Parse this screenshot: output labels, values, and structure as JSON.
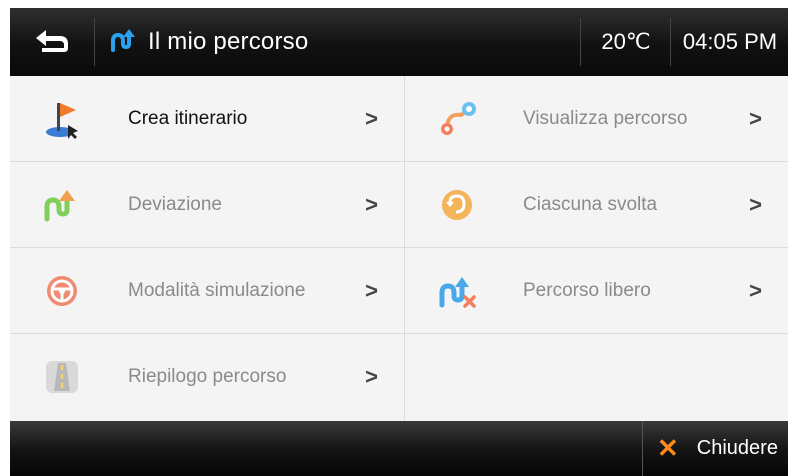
{
  "header": {
    "title": "Il mio percorso",
    "temperature": "20℃",
    "time": "04:05 PM"
  },
  "menu": {
    "items": [
      {
        "label": "Crea itinerario",
        "icon": "flag-route-icon",
        "active": true
      },
      {
        "label": "Visualizza percorso",
        "icon": "route-points-icon",
        "active": false
      },
      {
        "label": "Deviazione",
        "icon": "detour-arrow-icon",
        "active": false
      },
      {
        "label": "Ciascuna svolta",
        "icon": "u-turn-icon",
        "active": false
      },
      {
        "label": "Modalità simulazione",
        "icon": "steering-wheel-icon",
        "active": false
      },
      {
        "label": "Percorso libero",
        "icon": "free-route-icon",
        "active": false
      },
      {
        "label": "Riepilogo percorso",
        "icon": "road-icon",
        "active": false
      }
    ],
    "chevron": ">"
  },
  "footer": {
    "close_label": "Chiudere"
  },
  "colors": {
    "accent_orange": "#ff8a1a",
    "header_bg": "#111111",
    "list_bg": "#f4f4f4"
  }
}
